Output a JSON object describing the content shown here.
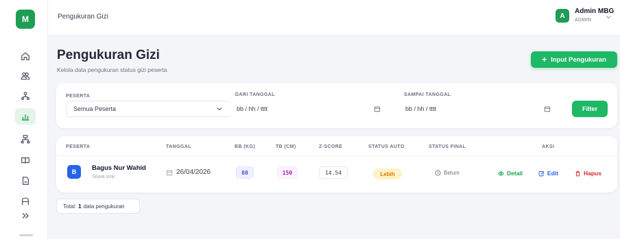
{
  "sidebar": {
    "logo": "M",
    "items": [
      {
        "icon": "home-icon"
      },
      {
        "icon": "users-icon"
      },
      {
        "icon": "people-icon"
      },
      {
        "icon": "chart-icon",
        "active": true
      },
      {
        "icon": "org-icon"
      },
      {
        "icon": "book-icon"
      },
      {
        "icon": "file-icon"
      },
      {
        "icon": "archive-icon"
      },
      {
        "icon": "expand-icon"
      }
    ]
  },
  "topbar": {
    "breadcrumb": "Pengukuran Gizi",
    "user": {
      "avatar": "A",
      "name": "Admin MBG",
      "role": "ADMIN"
    }
  },
  "header": {
    "title": "Pengukuran Gizi",
    "subtitle": "Kelola data pengukuran status gizi peserta",
    "add_button": "Input Pengukuran"
  },
  "filter": {
    "peserta_label": "PESERTA",
    "peserta_value": "Semua Peserta",
    "dari_label": "DARI TANGGAL",
    "dari_value": "bb / hh / tttt",
    "sampai_label": "SAMPAI TANGGAL",
    "sampai_value": "bb / hh / tttt",
    "button": "Filter"
  },
  "table": {
    "columns": [
      "PESERTA",
      "TANGGAL",
      "BB (KG)",
      "TB (CM)",
      "Z-SCORE",
      "STATUS AUTO",
      "STATUS FINAL",
      "AKSI"
    ],
    "rows": [
      {
        "avatar": "B",
        "name": "Bagus Nur Wahid",
        "sub": "Siswa smk",
        "tanggal": "26/04/2026",
        "bb": "80",
        "tb": "150",
        "zscore": "14.54",
        "status_auto": "Lebih",
        "status_final": "Belum",
        "actions": {
          "detail": "Detail",
          "edit": "Edit",
          "hapus": "Hapus"
        }
      }
    ]
  },
  "footer": {
    "total_prefix": "Total:",
    "total_count": "1",
    "total_suffix": "data pengukuran"
  },
  "colors": {
    "accent": "#1fb866",
    "brand": "#1f9d55",
    "active_bg": "#e3f4ea",
    "badge_lebih_bg": "#fef3c7",
    "badge_lebih_fg": "#d97706",
    "edit": "#2563eb",
    "delete": "#dc2626"
  }
}
